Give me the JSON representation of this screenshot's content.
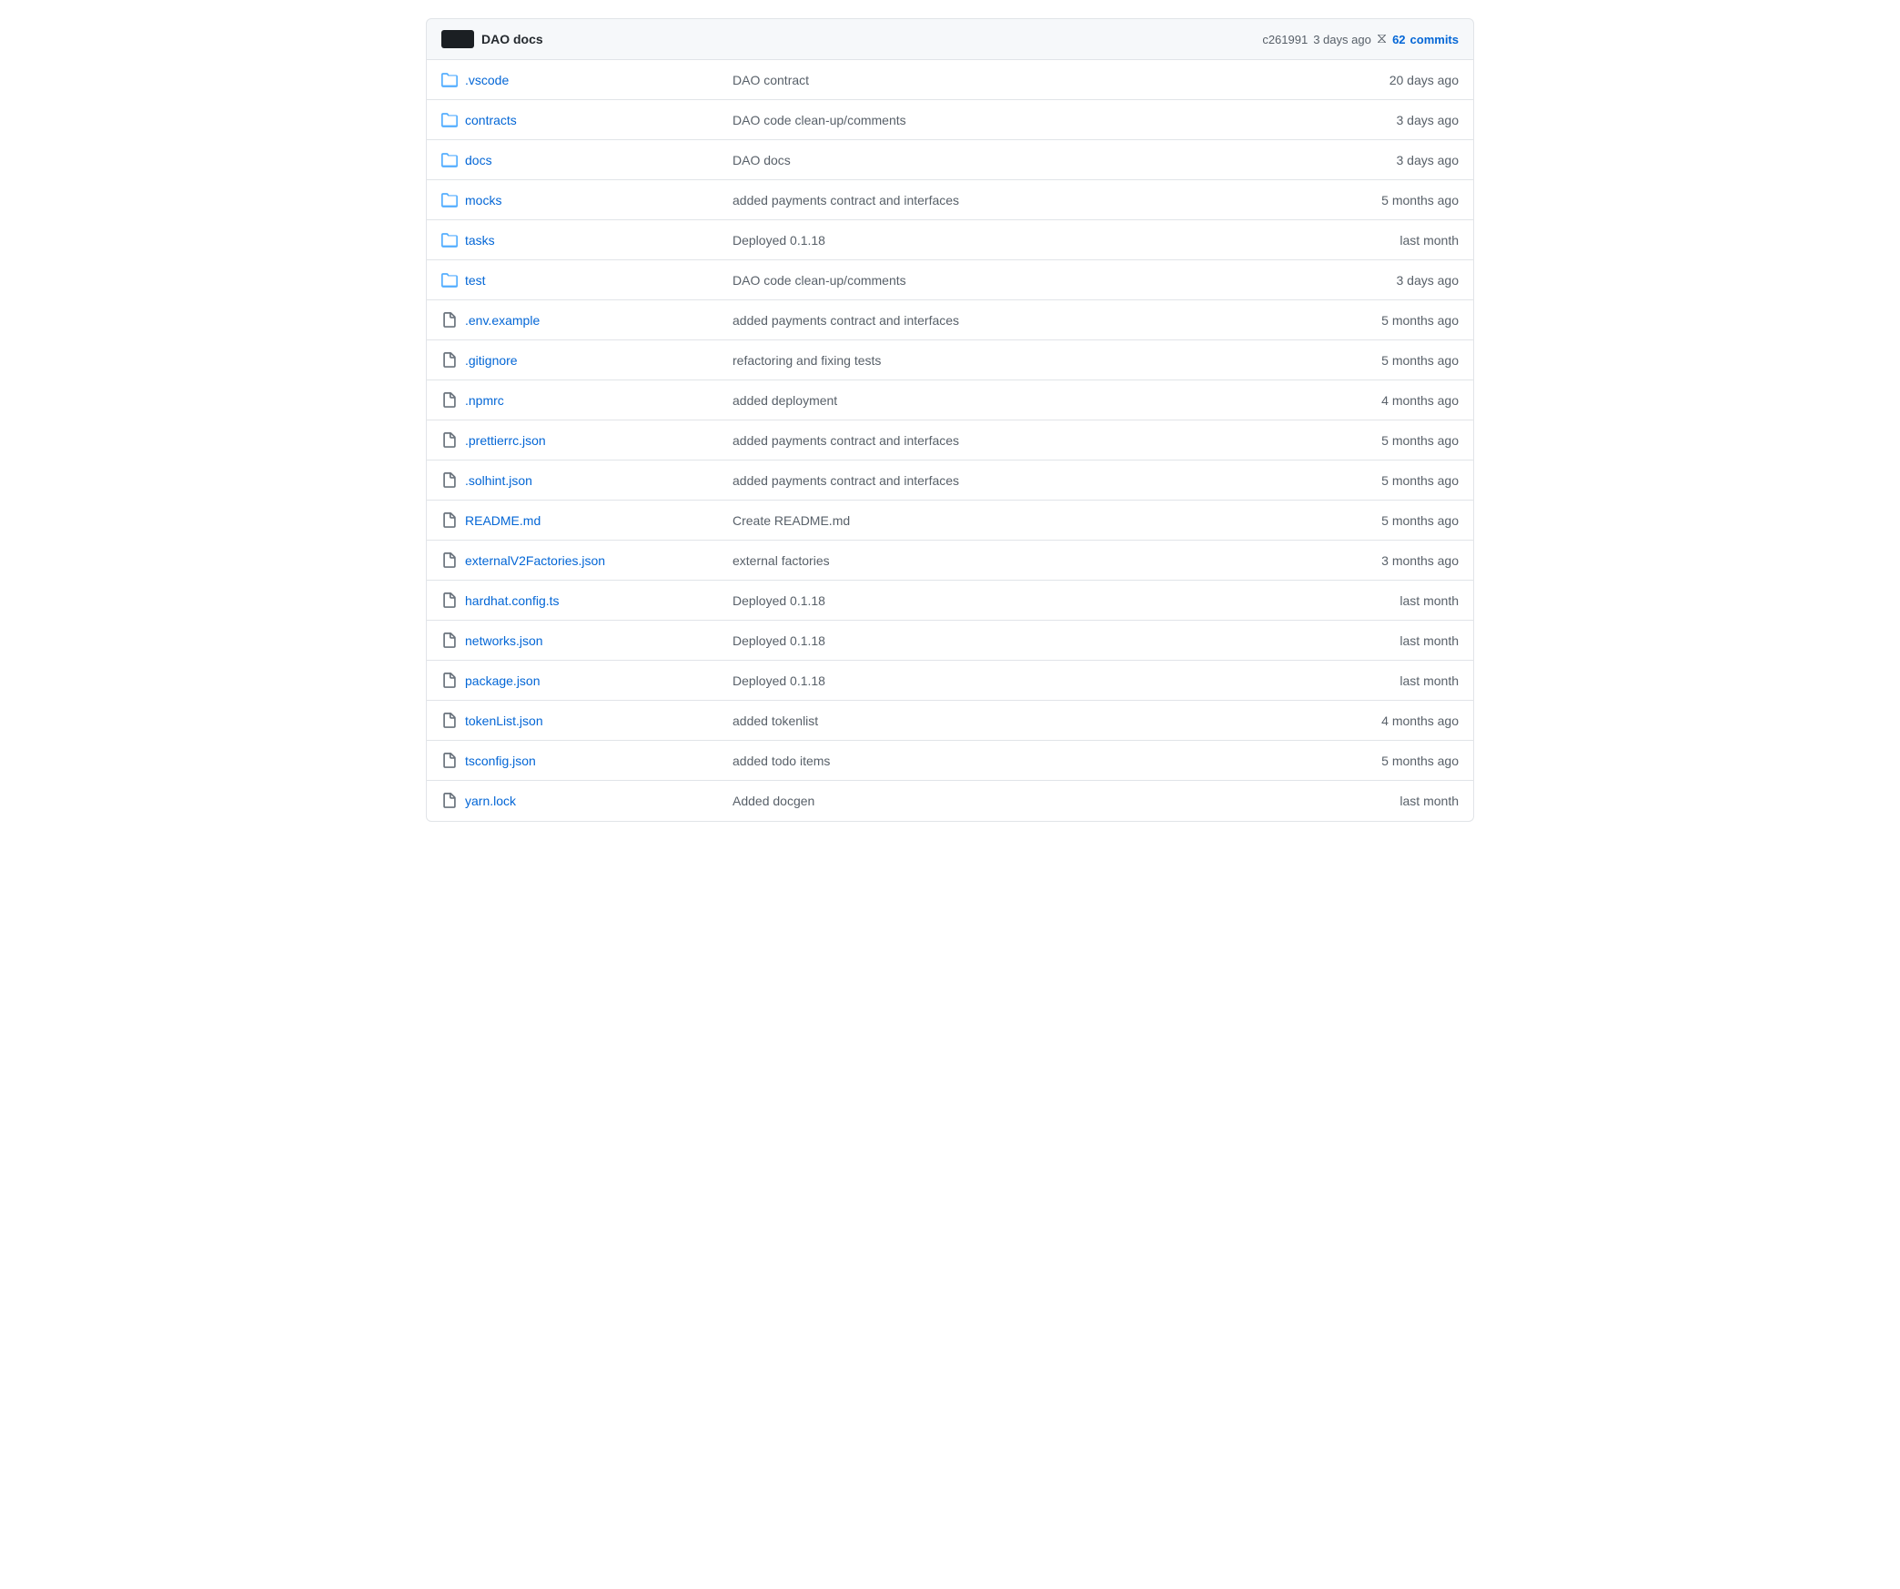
{
  "header": {
    "avatar_label": "user-avatar",
    "title": "DAO docs",
    "commit_hash": "c261991",
    "commit_time": "3 days ago",
    "commits_count": "62",
    "commits_label": "commits"
  },
  "files": [
    {
      "type": "folder",
      "name": ".vscode",
      "commit_message": "DAO contract",
      "time": "20 days ago"
    },
    {
      "type": "folder",
      "name": "contracts",
      "commit_message": "DAO code clean-up/comments",
      "time": "3 days ago"
    },
    {
      "type": "folder",
      "name": "docs",
      "commit_message": "DAO docs",
      "time": "3 days ago"
    },
    {
      "type": "folder",
      "name": "mocks",
      "commit_message": "added payments contract and interfaces",
      "time": "5 months ago"
    },
    {
      "type": "folder",
      "name": "tasks",
      "commit_message": "Deployed 0.1.18",
      "time": "last month"
    },
    {
      "type": "folder",
      "name": "test",
      "commit_message": "DAO code clean-up/comments",
      "time": "3 days ago"
    },
    {
      "type": "file",
      "name": ".env.example",
      "commit_message": "added payments contract and interfaces",
      "time": "5 months ago"
    },
    {
      "type": "file",
      "name": ".gitignore",
      "commit_message": "refactoring and fixing tests",
      "time": "5 months ago"
    },
    {
      "type": "file",
      "name": ".npmrc",
      "commit_message": "added deployment",
      "time": "4 months ago"
    },
    {
      "type": "file",
      "name": ".prettierrc.json",
      "commit_message": "added payments contract and interfaces",
      "time": "5 months ago"
    },
    {
      "type": "file",
      "name": ".solhint.json",
      "commit_message": "added payments contract and interfaces",
      "time": "5 months ago"
    },
    {
      "type": "file",
      "name": "README.md",
      "commit_message": "Create README.md",
      "time": "5 months ago"
    },
    {
      "type": "file",
      "name": "externalV2Factories.json",
      "commit_message": "external factories",
      "time": "3 months ago"
    },
    {
      "type": "file",
      "name": "hardhat.config.ts",
      "commit_message": "Deployed 0.1.18",
      "time": "last month"
    },
    {
      "type": "file",
      "name": "networks.json",
      "commit_message": "Deployed 0.1.18",
      "time": "last month"
    },
    {
      "type": "file",
      "name": "package.json",
      "commit_message": "Deployed 0.1.18",
      "time": "last month"
    },
    {
      "type": "file",
      "name": "tokenList.json",
      "commit_message": "added tokenlist",
      "time": "4 months ago"
    },
    {
      "type": "file",
      "name": "tsconfig.json",
      "commit_message": "added todo items",
      "time": "5 months ago"
    },
    {
      "type": "file",
      "name": "yarn.lock",
      "commit_message": "Added docgen",
      "time": "last month"
    }
  ]
}
